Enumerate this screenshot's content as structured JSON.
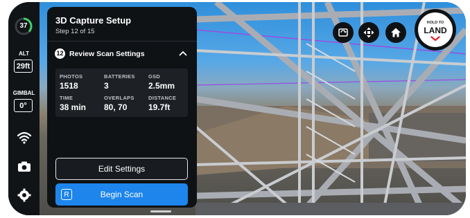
{
  "status": {
    "battery": "37",
    "alt_label": "ALT",
    "alt_value": "29ft",
    "gimbal_label": "GIMBAL",
    "gimbal_value": "0°"
  },
  "rail_icons": [
    "wifi-icon",
    "camera-icon",
    "gear-icon"
  ],
  "panel": {
    "title": "3D Capture Setup",
    "step": "Step 12 of 15",
    "section_number": "12",
    "section_title": "Review Scan Settings",
    "stats": [
      {
        "label": "PHOTOS",
        "value": "1518"
      },
      {
        "label": "BATTERIES",
        "value": "3"
      },
      {
        "label": "GSD",
        "value": "2.5mm"
      },
      {
        "label": "TIME",
        "value": "38 min"
      },
      {
        "label": "OVERLAPS",
        "value": "80, 70"
      },
      {
        "label": "DISTANCE",
        "value": "19.7ft"
      }
    ],
    "edit_label": "Edit Settings",
    "begin_label": "Begin Scan",
    "begin_icon_letter": "R"
  },
  "controls": {
    "land_small": "HOLD TO",
    "land_big": "LAND"
  },
  "colors": {
    "accent": "#1d85ec",
    "battery_ring": "#3fcf6a",
    "land_red": "#e0242b"
  }
}
